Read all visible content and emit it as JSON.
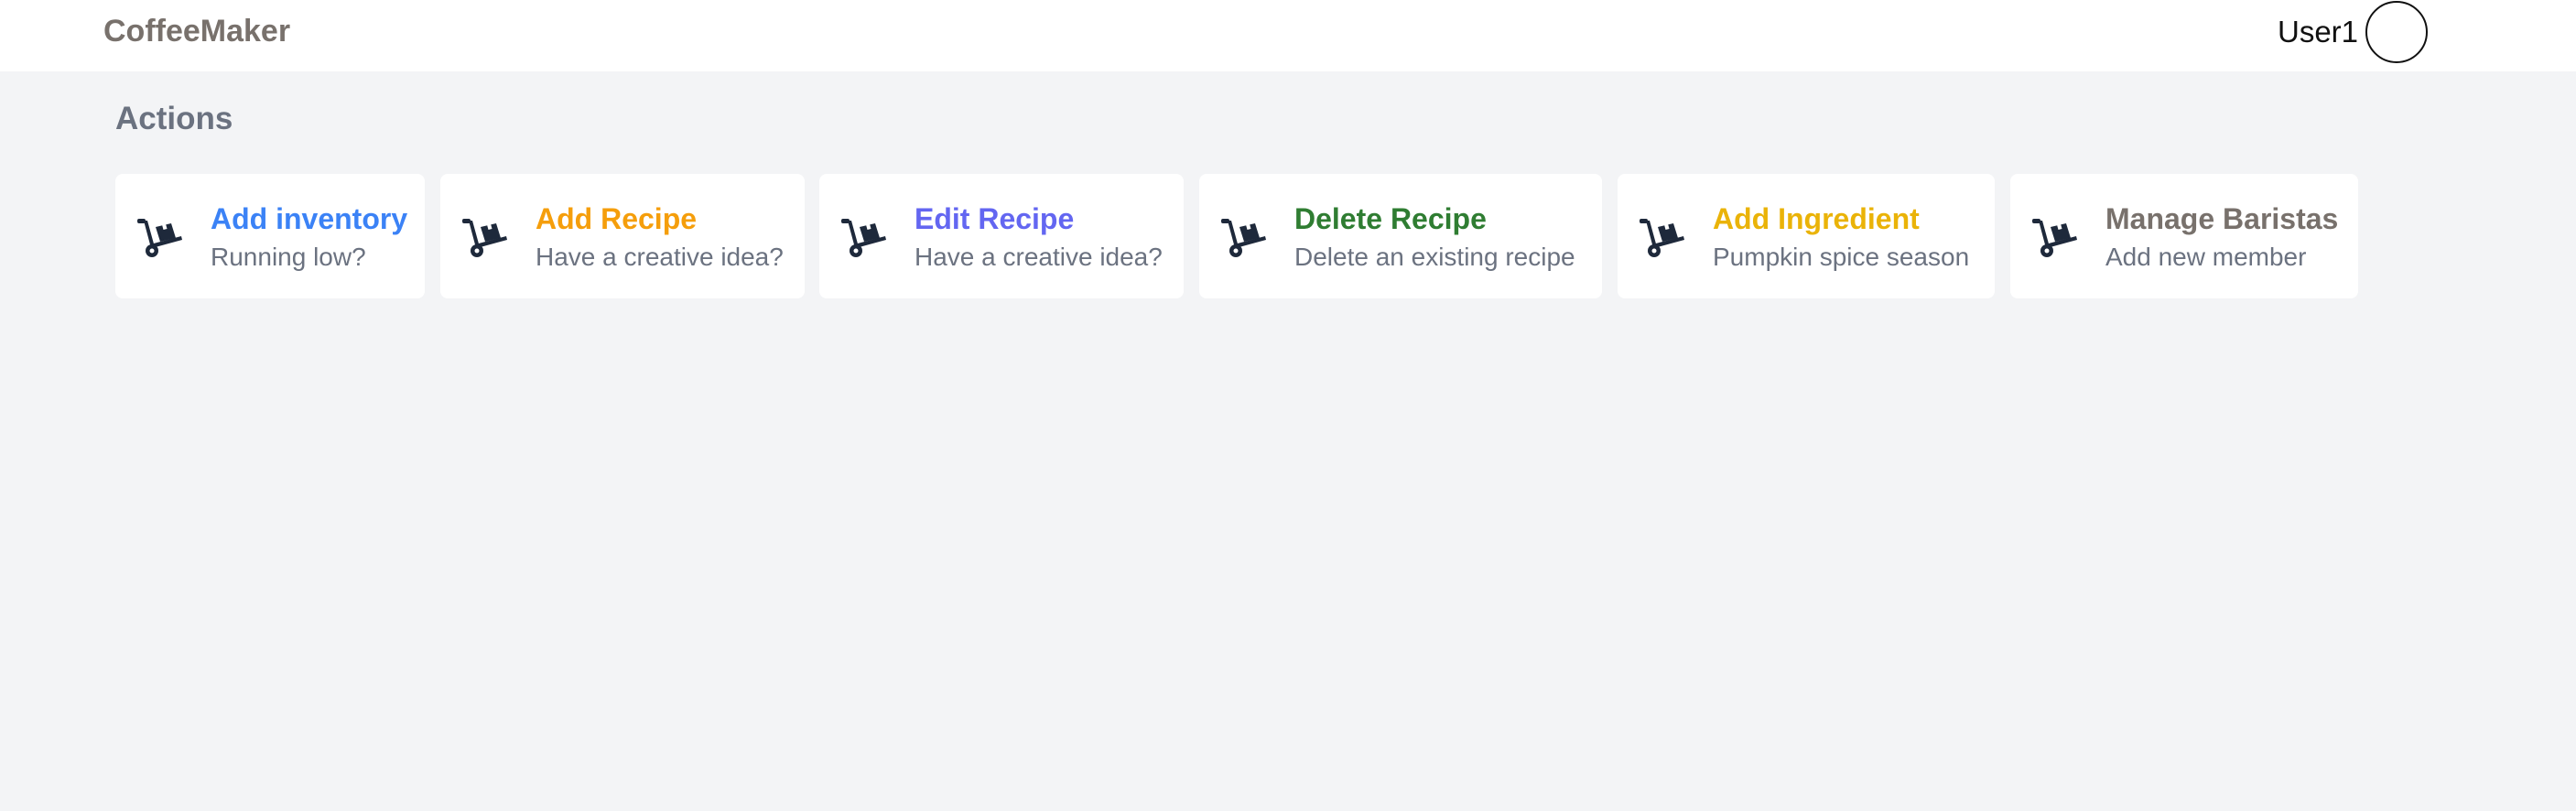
{
  "header": {
    "brand": "CoffeeMaker",
    "user_name": "User1"
  },
  "section": {
    "title": "Actions"
  },
  "cards": [
    {
      "title": "Add inventory",
      "subtitle": "Running low?",
      "color": "#3b82f6",
      "icon": "hand-truck-icon"
    },
    {
      "title": "Add Recipe",
      "subtitle": "Have a creative idea?",
      "color": "#f59e0b",
      "icon": "hand-truck-icon"
    },
    {
      "title": "Edit Recipe",
      "subtitle": "Have a creative idea?",
      "color": "#6366f1",
      "icon": "hand-truck-icon"
    },
    {
      "title": "Delete Recipe",
      "subtitle": "Delete an existing recipe",
      "color": "#2f7d32",
      "icon": "hand-truck-icon"
    },
    {
      "title": "Add Ingredient",
      "subtitle": "Pumpkin spice season",
      "color": "#eab308",
      "icon": "hand-truck-icon"
    },
    {
      "title": "Manage Baristas",
      "subtitle": "Add new member",
      "color": "#78716c",
      "icon": "hand-truck-icon"
    }
  ],
  "icon_color": "#1e293b"
}
